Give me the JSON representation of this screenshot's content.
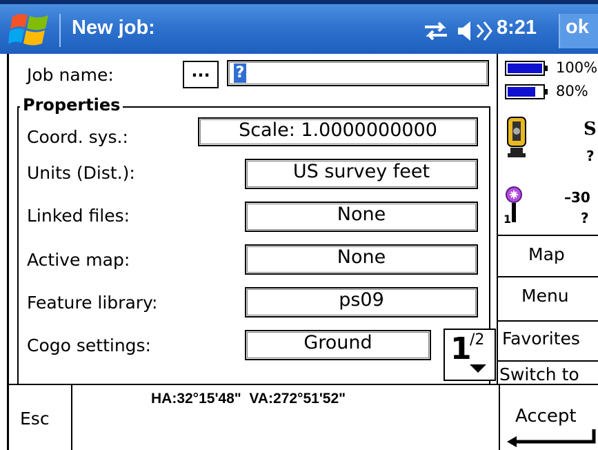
{
  "title_bar": {
    "title": "New job:",
    "time": "8:21",
    "ok_label": "ok"
  },
  "form": {
    "job_name_label": "Job name:",
    "browse_label": "...",
    "job_name_value": "?",
    "group_title": "Properties",
    "fields": [
      {
        "label": "Coord. sys.:",
        "value": "Scale:  1.0000000000"
      },
      {
        "label": "Units (Dist.):",
        "value": "US survey feet"
      },
      {
        "label": "Linked files:",
        "value": "None"
      },
      {
        "label": "Active map:",
        "value": "None"
      },
      {
        "label": "Feature library:",
        "value": "ps09"
      },
      {
        "label": "Cogo settings:",
        "value": "Ground"
      }
    ],
    "page_current": "1",
    "page_total": "/2"
  },
  "status_panel": {
    "battery1": "100%",
    "battery2": "80%",
    "battery1_level": 1.0,
    "battery2_level": 0.8,
    "instrument_status": "S",
    "instrument_value": "?",
    "target_value": "–30",
    "target_value2": "?",
    "target_number": "1"
  },
  "side_buttons": {
    "map": "Map",
    "menu": "Menu",
    "favorites": "Favorites",
    "switch_to": "Switch to"
  },
  "bottom": {
    "esc_label": "Esc",
    "angles": "HA:32°15'48\"  VA:272°51'52\"",
    "accept_label": "Accept"
  },
  "colors": {
    "title_bar": "#2f73cf",
    "battery_fill": "#1010d0",
    "cursor_highlight": "#2f6fd1"
  }
}
